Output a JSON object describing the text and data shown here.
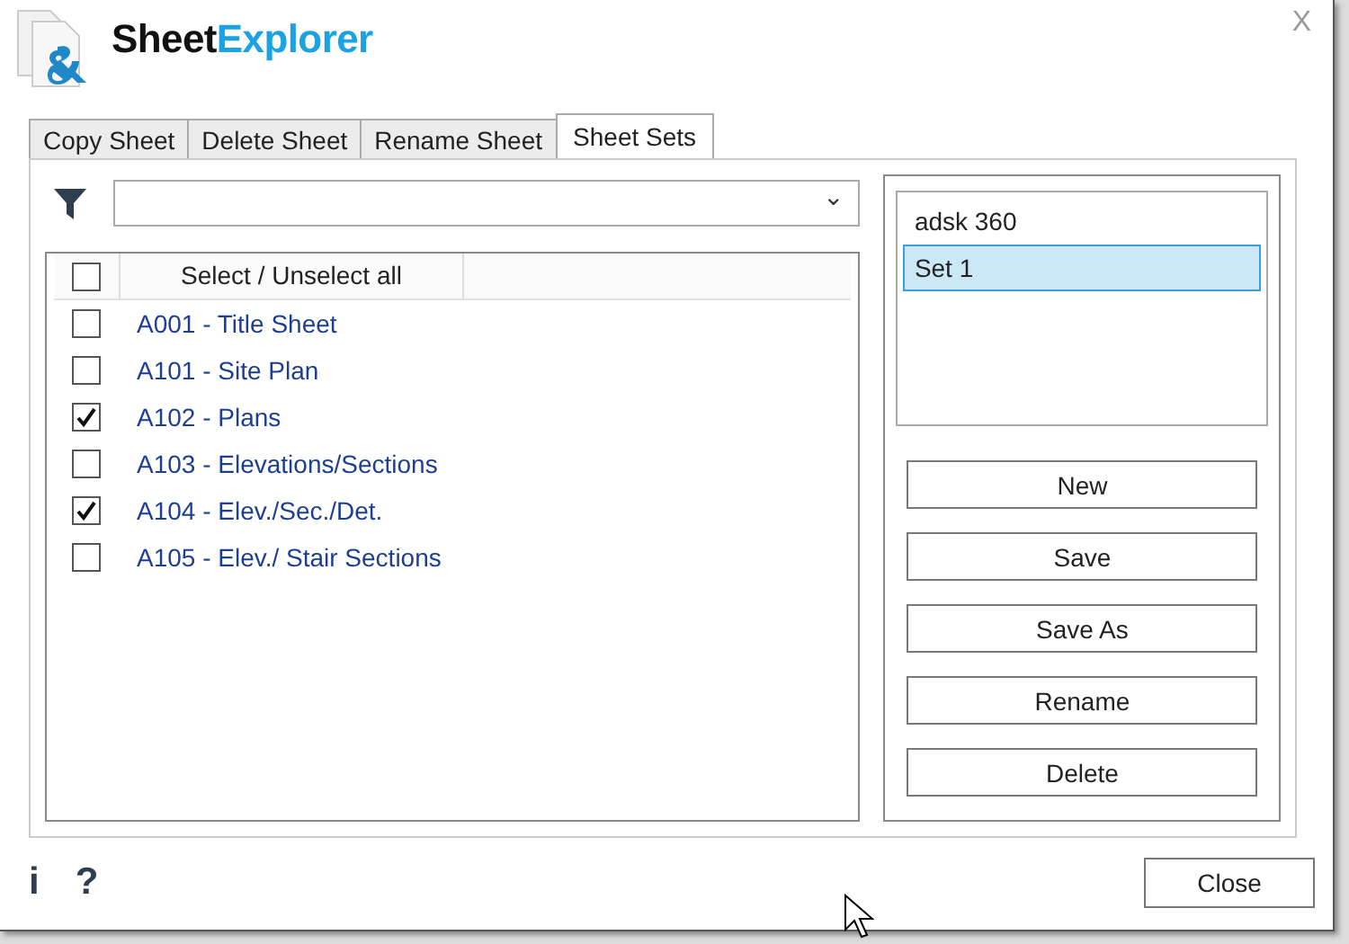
{
  "window": {
    "title_part_1": "Sheet",
    "title_part_2": "Explorer",
    "close": "X"
  },
  "tabs": [
    {
      "label": "Copy Sheet",
      "selected": false
    },
    {
      "label": "Delete Sheet",
      "selected": false
    },
    {
      "label": "Rename Sheet",
      "selected": false
    },
    {
      "label": "Sheet Sets",
      "selected": true
    }
  ],
  "filter": {
    "dropdown_arrow": "⌄"
  },
  "sheet_list": {
    "header": {
      "label": "Select / Unselect all",
      "checked": false
    },
    "rows": [
      {
        "label": "A001 - Title Sheet",
        "checked": false
      },
      {
        "label": "A101 - Site Plan",
        "checked": false
      },
      {
        "label": "A102 - Plans",
        "checked": true
      },
      {
        "label": "A103 - Elevations/Sections",
        "checked": false
      },
      {
        "label": "A104 - Elev./Sec./Det.",
        "checked": true
      },
      {
        "label": "A105 - Elev./ Stair Sections",
        "checked": false
      }
    ]
  },
  "sets": [
    {
      "label": "adsk 360",
      "selected": false
    },
    {
      "label": "Set 1",
      "selected": true
    }
  ],
  "set_buttons": [
    "New",
    "Save",
    "Save As",
    "Rename",
    "Delete"
  ],
  "footer": {
    "info": "i",
    "help": "?",
    "close_button": "Close"
  }
}
